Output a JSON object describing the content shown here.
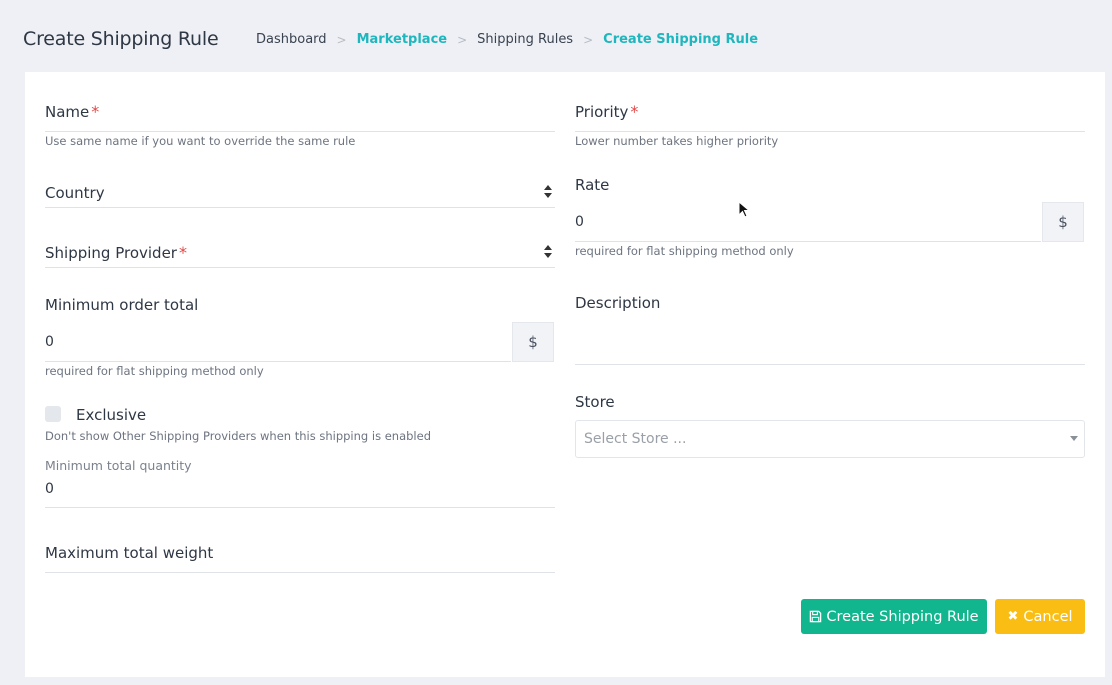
{
  "header": {
    "title": "Create Shipping Rule",
    "breadcrumb": [
      "Dashboard",
      "Marketplace",
      "Shipping Rules",
      "Create Shipping Rule"
    ]
  },
  "form": {
    "name": {
      "label": "Name",
      "required_mark": "*",
      "help": "Use same name if you want to override the same rule"
    },
    "priority": {
      "label": "Priority",
      "required_mark": "*",
      "help": "Lower number takes higher priority"
    },
    "country": {
      "label": "Country"
    },
    "rate": {
      "label": "Rate",
      "value": "0",
      "addon": "$",
      "help": "required for flat shipping method only"
    },
    "shipping_provider": {
      "label": "Shipping Provider",
      "required_mark": "*"
    },
    "min_order_total": {
      "label": "Minimum order total",
      "value": "0",
      "addon": "$",
      "help": "required for flat shipping method only"
    },
    "description": {
      "label": "Description"
    },
    "exclusive": {
      "label": "Exclusive",
      "help": "Don't show Other Shipping Providers when this shipping is enabled"
    },
    "store": {
      "label": "Store",
      "placeholder": "Select Store ..."
    },
    "min_total_quantity": {
      "label": "Minimum total quantity",
      "value": "0"
    },
    "max_total_weight": {
      "label": "Maximum total weight"
    }
  },
  "buttons": {
    "create": "Create Shipping Rule",
    "cancel": "Cancel"
  },
  "colors": {
    "accent": "#1fb6bd",
    "create_button": "#12b68e",
    "cancel_button": "#f9bd13",
    "required": "#e04848"
  }
}
